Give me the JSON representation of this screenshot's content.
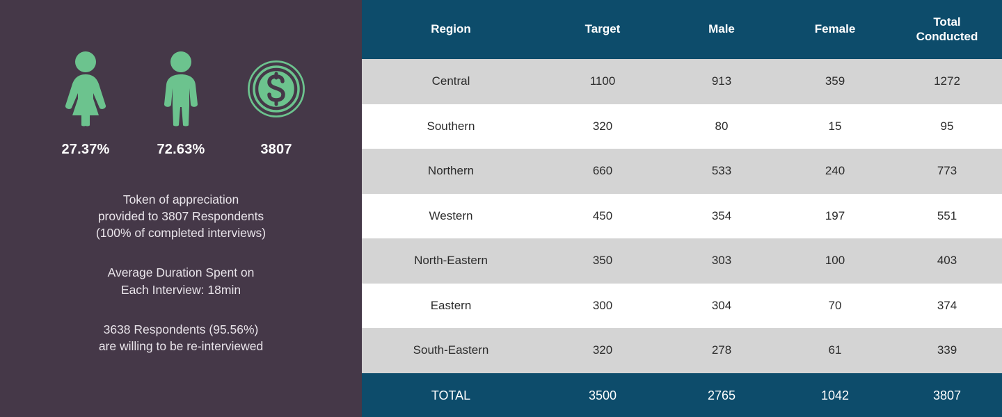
{
  "colors": {
    "left_panel_bg": "#453848",
    "header_bg": "#0d4c6b",
    "accent_green": "#6cc38e",
    "row_alt_bg": "#d4d4d4",
    "row_bg": "#ffffff",
    "text_light": "#ffffff"
  },
  "left_panel": {
    "stats": [
      {
        "icon": "female-figure-icon",
        "value": "27.37%"
      },
      {
        "icon": "male-figure-icon",
        "value": "72.63%"
      },
      {
        "icon": "dollar-coin-icon",
        "value": "3807"
      }
    ],
    "notes": [
      {
        "lines": [
          "Token of appreciation",
          "provided to 3807 Respondents",
          "(100% of completed interviews)"
        ]
      },
      {
        "lines": [
          "Average Duration Spent on",
          "Each Interview: 18min"
        ]
      },
      {
        "lines": [
          "3638 Respondents (95.56%)",
          "are willing to be re-interviewed"
        ]
      }
    ]
  },
  "table": {
    "headers": [
      "Region",
      "Target",
      "Male",
      "Female",
      "Total\nConducted"
    ],
    "rows": [
      {
        "region": "Central",
        "target": "1100",
        "male": "913",
        "female": "359",
        "total": "1272"
      },
      {
        "region": "Southern",
        "target": "320",
        "male": "80",
        "female": "15",
        "total": "95"
      },
      {
        "region": "Northern",
        "target": "660",
        "male": "533",
        "female": "240",
        "total": "773"
      },
      {
        "region": "Western",
        "target": "450",
        "male": "354",
        "female": "197",
        "total": "551"
      },
      {
        "region": "North-Eastern",
        "target": "350",
        "male": "303",
        "female": "100",
        "total": "403"
      },
      {
        "region": "Eastern",
        "target": "300",
        "male": "304",
        "female": "70",
        "total": "374"
      },
      {
        "region": "South-Eastern",
        "target": "320",
        "male": "278",
        "female": "61",
        "total": "339"
      }
    ],
    "footer": {
      "region": "TOTAL",
      "target": "3500",
      "male": "2765",
      "female": "1042",
      "total": "3807"
    }
  }
}
